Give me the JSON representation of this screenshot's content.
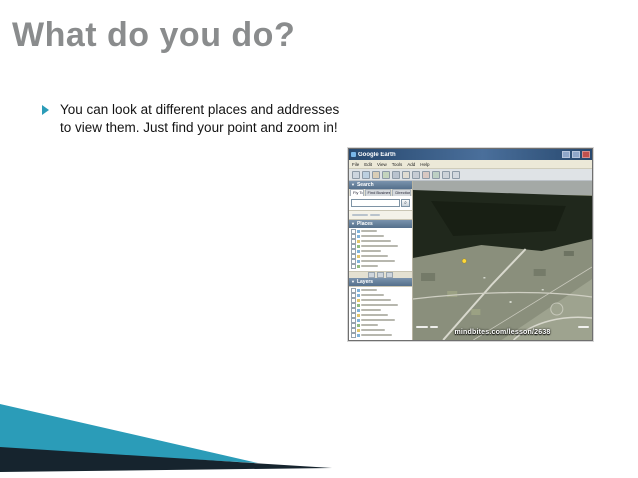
{
  "slide": {
    "title": "What do you do?",
    "bullets": [
      "You can look at different places and addresses to view them. Just find your point and zoom in!"
    ]
  },
  "colors": {
    "title_gray": "#8a8c8d",
    "accent_teal": "#2b9cb8",
    "accent_dark": "#16242e",
    "titlebar_blue": "#27486e"
  },
  "earth_window": {
    "title": "Google Earth",
    "menu": [
      "File",
      "Edit",
      "View",
      "Tools",
      "Add",
      "Help"
    ],
    "search_panel": {
      "header": "Search",
      "tabs": [
        "Fly To",
        "Find Businesses",
        "Directions"
      ],
      "search_button_icon": "magnifier-icon"
    },
    "places_panel": {
      "header": "Places"
    },
    "layers_panel": {
      "header": "Layers"
    },
    "map": {
      "watermark": "mindbites.com/lesson/2638"
    }
  }
}
